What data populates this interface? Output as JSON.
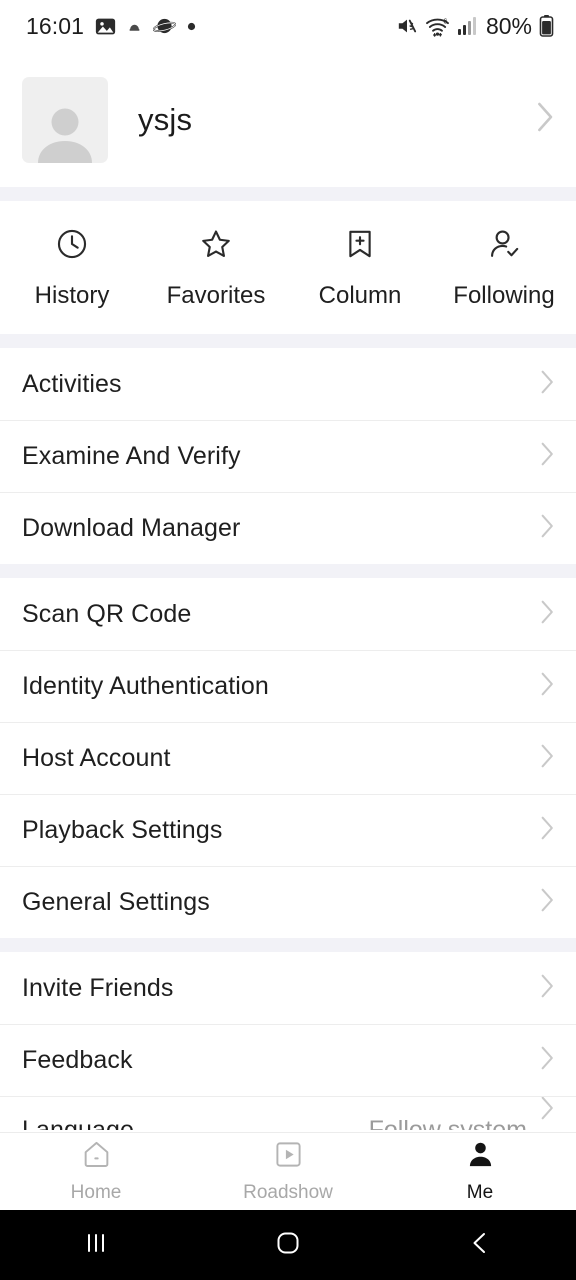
{
  "status_bar": {
    "time": "16:01",
    "battery_percent": "80%",
    "left_icons": [
      "image-icon",
      "cloud-icon",
      "oval-icon",
      "dot-icon"
    ],
    "right_icons": [
      "mute-icon",
      "wifi-icon",
      "signal-icon",
      "battery-icon"
    ]
  },
  "profile": {
    "name": "ysjs",
    "avatar_icon": "default-avatar-icon",
    "chevron": "chevron-right-icon"
  },
  "quick_access": [
    {
      "label": "History",
      "icon": "clock-icon"
    },
    {
      "label": "Favorites",
      "icon": "star-icon"
    },
    {
      "label": "Column",
      "icon": "bookmark-plus-icon"
    },
    {
      "label": "Following",
      "icon": "person-check-icon"
    }
  ],
  "groups": [
    {
      "name": "content-group",
      "rows": [
        {
          "label": "Activities",
          "value": ""
        },
        {
          "label": "Examine And Verify",
          "value": ""
        },
        {
          "label": "Download Manager",
          "value": ""
        }
      ]
    },
    {
      "name": "account-group",
      "rows": [
        {
          "label": "Scan QR Code",
          "value": ""
        },
        {
          "label": "Identity Authentication",
          "value": ""
        },
        {
          "label": "Host Account",
          "value": ""
        },
        {
          "label": "Playback Settings",
          "value": ""
        },
        {
          "label": "General Settings",
          "value": ""
        }
      ]
    },
    {
      "name": "support-group",
      "rows": [
        {
          "label": "Invite Friends",
          "value": ""
        },
        {
          "label": "Feedback",
          "value": ""
        },
        {
          "label": "Language",
          "value": "Follow system",
          "clipped": true
        }
      ]
    }
  ],
  "tabbar": [
    {
      "label": "Home",
      "icon": "home-icon",
      "active": false
    },
    {
      "label": "Roadshow",
      "icon": "play-square-icon",
      "active": false
    },
    {
      "label": "Me",
      "icon": "person-filled-icon",
      "active": true
    }
  ],
  "system_nav": [
    {
      "name": "recents-button",
      "icon": "recents-icon"
    },
    {
      "name": "home-button",
      "icon": "home-square-icon"
    },
    {
      "name": "back-button",
      "icon": "back-chevron-icon"
    }
  ],
  "colors": {
    "background": "#ffffff",
    "separator": "#f2f2f7",
    "divider": "#ededed",
    "text_primary": "#1f1f1f",
    "text_muted": "#a8a8a8",
    "chevron": "#c9c9c9",
    "navbar": "#000000"
  }
}
